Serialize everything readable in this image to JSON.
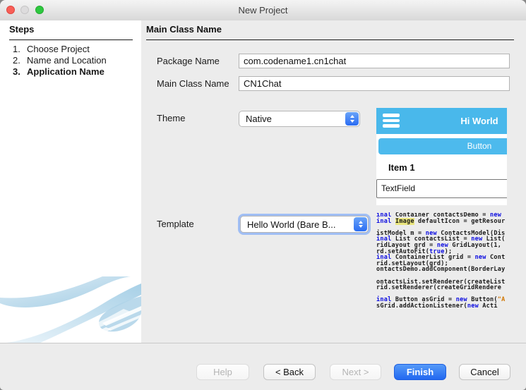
{
  "window": {
    "title": "New Project"
  },
  "sidebar": {
    "heading": "Steps",
    "steps": [
      {
        "number": "1.",
        "label": "Choose Project"
      },
      {
        "number": "2.",
        "label": "Name and Location"
      },
      {
        "number": "3.",
        "label": "Application Name"
      }
    ]
  },
  "main": {
    "heading": "Main Class Name",
    "fields": {
      "package_name": {
        "label": "Package Name",
        "value": "com.codename1.cn1chat"
      },
      "main_class_name": {
        "label": "Main Class Name",
        "value": "CN1Chat"
      },
      "theme": {
        "label": "Theme",
        "value": "Native"
      },
      "template": {
        "label": "Template",
        "value": "Hello World (Bare B..."
      }
    },
    "preview": {
      "titlebar_text": "Hi World",
      "button_label": "Button",
      "item_label": "Item 1",
      "textfield_value": "TextField"
    },
    "code": {
      "lines": [
        [
          {
            "t": "inal ",
            "y": "k"
          },
          {
            "t": "Container contactsDemo = "
          },
          {
            "t": "new",
            "y": "k"
          }
        ],
        [
          {
            "t": "inal ",
            "y": "k"
          },
          {
            "t": "Image",
            "y": "h"
          },
          {
            "t": " defaultIcon = getResour"
          }
        ],
        [],
        [
          {
            "t": "istModel m = "
          },
          {
            "t": "new",
            "y": "k"
          },
          {
            "t": " ContactsModel(Dis"
          }
        ],
        [
          {
            "t": "inal ",
            "y": "k"
          },
          {
            "t": "List contactsList = "
          },
          {
            "t": "new",
            "y": "k"
          },
          {
            "t": " List("
          }
        ],
        [
          {
            "t": "ridLayout grd = "
          },
          {
            "t": "new",
            "y": "k"
          },
          {
            "t": " GridLayout(1,"
          }
        ],
        [
          {
            "t": "rd.setAutoFit("
          },
          {
            "t": "true",
            "y": "k"
          },
          {
            "t": ");"
          }
        ],
        [
          {
            "t": "inal ",
            "y": "k"
          },
          {
            "t": "ContainerList grid = "
          },
          {
            "t": "new",
            "y": "k"
          },
          {
            "t": " Cont"
          }
        ],
        [
          {
            "t": "rid.setLayout(grd);"
          }
        ],
        [
          {
            "t": "ontactsDemo.addComponent(BorderLay"
          }
        ],
        [],
        [
          {
            "t": "ontactsList.setRenderer(createList"
          }
        ],
        [
          {
            "t": "rid.setRenderer(createGridRendere"
          }
        ],
        [],
        [
          {
            "t": "inal ",
            "y": "k"
          },
          {
            "t": "Button asGrid = "
          },
          {
            "t": "new",
            "y": "k"
          },
          {
            "t": " Button("
          },
          {
            "t": "\"A",
            "y": "s"
          }
        ],
        [
          {
            "t": "sGrid.addActionListener("
          },
          {
            "t": "new",
            "y": "k"
          },
          {
            "t": " Acti"
          }
        ]
      ]
    }
  },
  "footer": {
    "help": "Help",
    "back": "< Back",
    "next": "Next >",
    "finish": "Finish",
    "cancel": "Cancel"
  },
  "colors": {
    "preview_blue": "#49b8eb",
    "primary_button_blue": "#2e6ff2",
    "keyword_blue": "#0c0ce0",
    "string_orange": "#d17500",
    "highlight_yellow": "#ebe77f",
    "traffic_red": "#f85f57",
    "traffic_gray": "#dddcdd",
    "traffic_green": "#2dc83f"
  }
}
